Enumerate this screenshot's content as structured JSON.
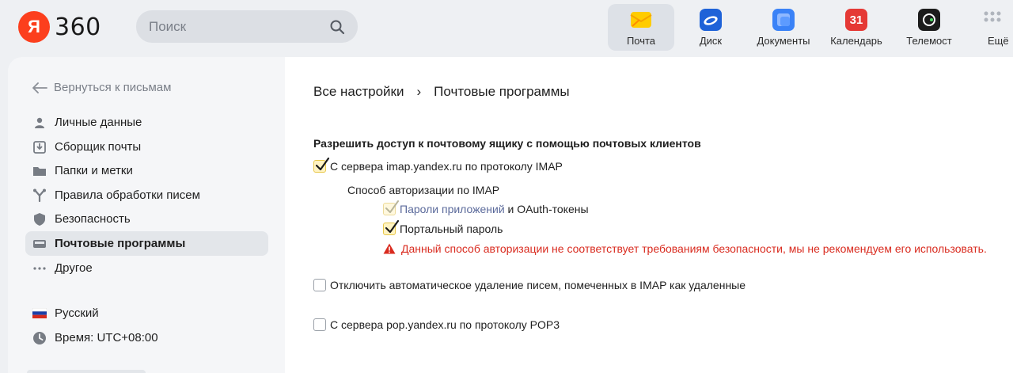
{
  "header": {
    "logo_ya": "Я",
    "logo_360": "360",
    "search_placeholder": "Поиск",
    "apps": [
      {
        "label": "Почта",
        "icon": "mail-icon",
        "color": "#ffcc00"
      },
      {
        "label": "Диск",
        "icon": "disk-icon",
        "color": "#1e62d8"
      },
      {
        "label": "Документы",
        "icon": "documents-icon",
        "color": "#3a82f7"
      },
      {
        "label": "Календарь",
        "icon": "calendar-icon",
        "color": "#e53935",
        "badge": "31"
      },
      {
        "label": "Телемост",
        "icon": "telemost-icon",
        "color": "#1c1c1c"
      },
      {
        "label": "Ещё",
        "icon": "more-icon",
        "color": "#b0b5bd"
      }
    ]
  },
  "sidebar": {
    "back_label": "Вернуться к письмам",
    "items": [
      {
        "label": "Личные данные",
        "icon": "person-icon"
      },
      {
        "label": "Сборщик почты",
        "icon": "collector-icon"
      },
      {
        "label": "Папки и метки",
        "icon": "folder-icon"
      },
      {
        "label": "Правила обработки писем",
        "icon": "rules-icon"
      },
      {
        "label": "Безопасность",
        "icon": "shield-icon"
      },
      {
        "label": "Почтовые программы",
        "icon": "mail-programs-icon",
        "active": true
      },
      {
        "label": "Другое",
        "icon": "more-dots-icon"
      }
    ],
    "language": "Русский",
    "time": "Время: UTC+08:00"
  },
  "main": {
    "breadcrumb_root": "Все настройки",
    "breadcrumb_sep": "›",
    "breadcrumb_current": "Почтовые программы",
    "section_title": "Разрешить доступ к почтовому ящику с помощью почтовых клиентов",
    "imap_label": "С сервера imap.yandex.ru по протоколу IMAP",
    "imap_checked": true,
    "auth_method_label": "Способ авторизации по IMAP",
    "app_passwords_link": "Пароли приложений",
    "app_passwords_suffix": " и OAuth-токены",
    "app_passwords_checked": true,
    "portal_password_label": "Портальный пароль",
    "portal_password_checked": true,
    "warning_text": "Данный способ авторизации не соответствует требованиям безопасности, мы не рекомендуем его использовать.",
    "disable_autodelete_label": "Отключить автоматическое удаление писем, помеченных в IMAP как удаленные",
    "disable_autodelete_checked": false,
    "pop3_label": "С сервера pop.yandex.ru по протоколу POP3",
    "pop3_checked": false
  },
  "colors": {
    "accent_yellow": "#ffcc00",
    "warning_red": "#d92b1f",
    "link": "#5b6a9b"
  }
}
